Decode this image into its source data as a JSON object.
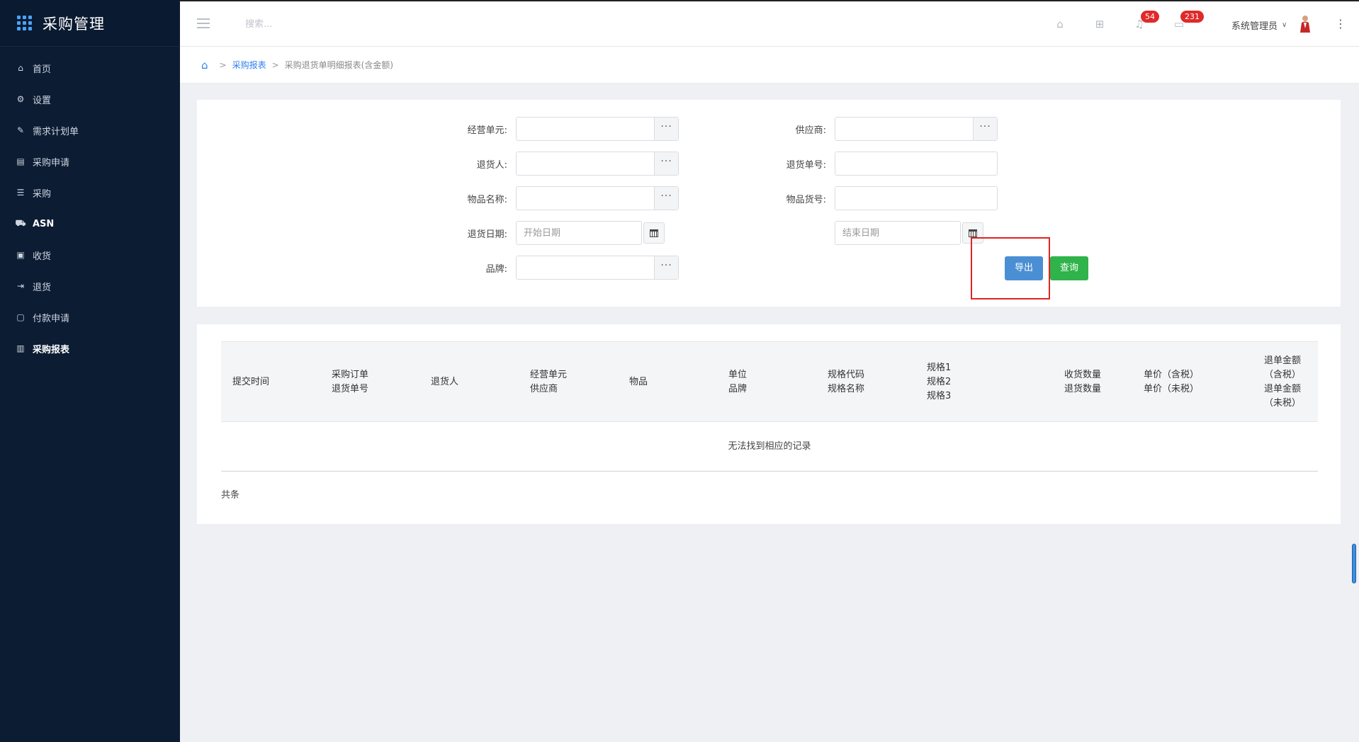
{
  "app": {
    "title": "采购管理"
  },
  "sidebar": {
    "items": [
      {
        "label": "首页",
        "icon": "home-icon"
      },
      {
        "label": "设置",
        "icon": "gear-icon"
      },
      {
        "label": "需求计划单",
        "icon": "document-edit-icon"
      },
      {
        "label": "采购申请",
        "icon": "clipboard-icon"
      },
      {
        "label": "采购",
        "icon": "list-doc-icon"
      },
      {
        "label": "ASN",
        "icon": "truck-icon"
      },
      {
        "label": "收货",
        "icon": "inbox-icon"
      },
      {
        "label": "退货",
        "icon": "sign-out-icon"
      },
      {
        "label": "付款申请",
        "icon": "payment-doc-icon"
      },
      {
        "label": "采购报表",
        "icon": "bar-chart-icon"
      }
    ]
  },
  "topbar": {
    "search_placeholder": "搜索...",
    "notifications_count": "54",
    "messages_count": "231",
    "user_name": "系统管理员"
  },
  "breadcrumb": {
    "parent": "采购报表",
    "current": "采购退货单明细报表(含金额)"
  },
  "filters": {
    "business_unit_label": "经营单元:",
    "supplier_label": "供应商:",
    "returner_label": "退货人:",
    "return_no_label": "退货单号:",
    "item_name_label": "物品名称:",
    "item_code_label": "物品货号:",
    "return_date_label": "退货日期:",
    "start_date_placeholder": "开始日期",
    "end_date_placeholder": "结束日期",
    "brand_label": "品牌:",
    "ellipsis": "···"
  },
  "actions": {
    "export_label": "导出",
    "query_label": "查询"
  },
  "table": {
    "columns": [
      {
        "lines": [
          "提交时间"
        ]
      },
      {
        "lines": [
          "采购订单",
          "退货单号"
        ]
      },
      {
        "lines": [
          "退货人"
        ]
      },
      {
        "lines": [
          "经营单元",
          "供应商"
        ]
      },
      {
        "lines": [
          "物品"
        ]
      },
      {
        "lines": [
          "单位",
          "品牌"
        ]
      },
      {
        "lines": [
          "规格代码",
          "规格名称"
        ]
      },
      {
        "lines": [
          "规格1",
          "规格2",
          "规格3"
        ]
      },
      {
        "lines": [
          "收货数量",
          "退货数量"
        ]
      },
      {
        "lines": [
          "单价（含税）",
          "单价（未税）"
        ]
      },
      {
        "lines": [
          "退单金额",
          "（含税）",
          "退单金额",
          "（未税）"
        ]
      }
    ],
    "empty_message": "无法找到相应的记录",
    "footer_text": "共条"
  },
  "colors": {
    "sidebar_bg": "#0b1c33",
    "export_button": "#4a8fd4",
    "query_button": "#2fb34a",
    "badge": "#e02a2a",
    "highlight_box": "#e02424"
  }
}
